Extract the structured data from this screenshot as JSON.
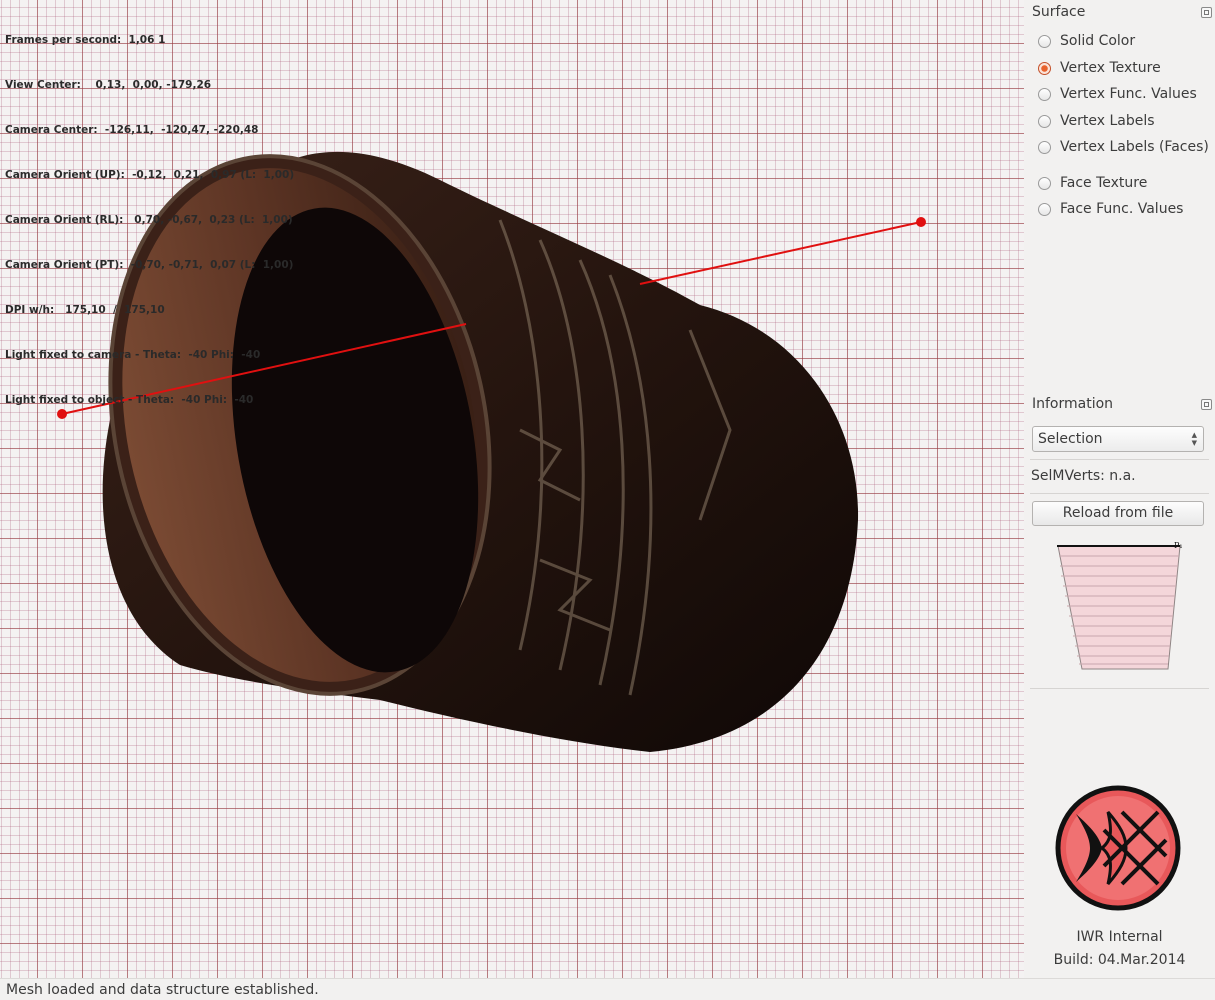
{
  "hud": {
    "lines": [
      "Frames per second:  1,06 1",
      "View Center:    0,13,  0,00, -179,26",
      "Camera Center:  -126,11,  -120,47, -220,48",
      "Camera Orient (UP):  -0,12,  0,21,  0,97 (L:  1,00)",
      "Camera Orient (RL):   0,70, -0,67,  0,23 (L:  1,00)",
      "Camera Orient (PT):  -0,70, -0,71,  0,07 (L:  1,00)",
      "DPI w/h:   175,10  /  175,10",
      "Light fixed to camera - Theta:  -40 Phi:  -40",
      "Light fixed to object - Theta:  -40 Phi:  -40"
    ]
  },
  "surface": {
    "title": "Surface",
    "options": [
      {
        "label": "Solid Color",
        "checked": false
      },
      {
        "label": "Vertex Texture",
        "checked": true
      },
      {
        "label": "Vertex Func. Values",
        "checked": false
      },
      {
        "label": "Vertex Labels",
        "checked": false
      },
      {
        "label": "Vertex Labels (Faces)",
        "checked": false
      },
      {
        "label": "Face Texture",
        "checked": false
      },
      {
        "label": "Face Func. Values",
        "checked": false
      }
    ]
  },
  "information": {
    "title": "Information",
    "combo_value": "Selection",
    "selmverts": "SelMVerts: n.a.",
    "reload_label": "Reload from file",
    "profile_label": "P₁"
  },
  "build": {
    "name": "IWR Internal",
    "date": "Build: 04.Mar.2014"
  },
  "status": {
    "message": "Mesh loaded and data structure established."
  },
  "icons": {
    "float": "float-window-icon",
    "logo": "iwr-logo-icon",
    "combo_arrows": "updown-arrows-icon"
  },
  "colors": {
    "accent": "#e8622d",
    "line": "#e01010",
    "logo_red": "#e8585a"
  }
}
